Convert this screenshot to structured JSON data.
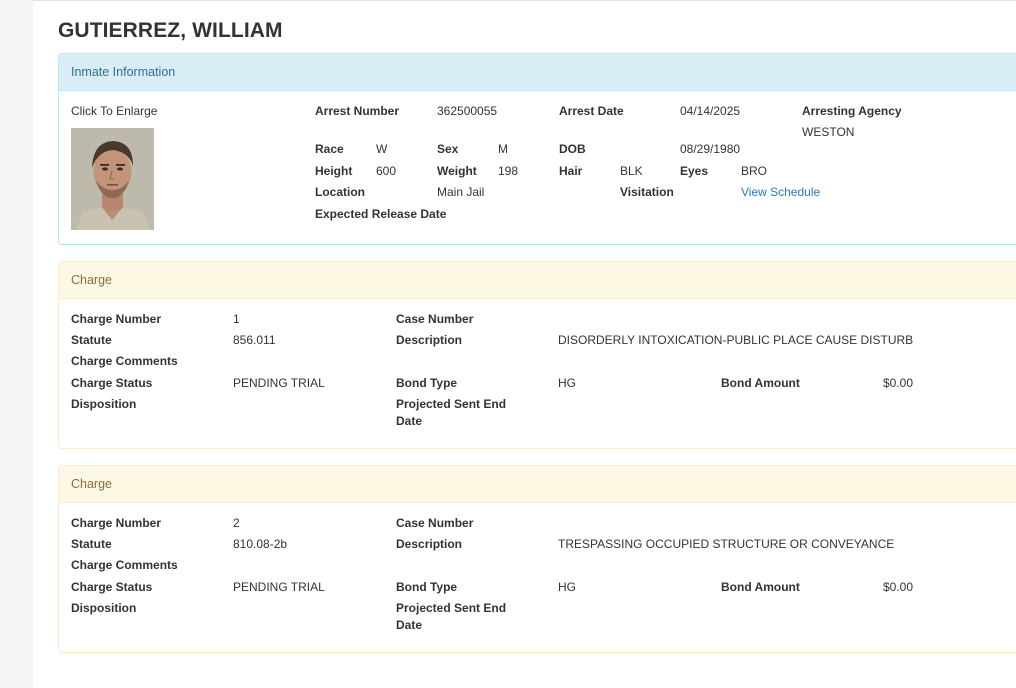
{
  "inmate": {
    "name": "GUTIERREZ, WILLIAM",
    "panel_title": "Inmate Information",
    "photo_label": "Click To Enlarge",
    "fields": {
      "arrest_number_label": "Arrest Number",
      "arrest_number": "362500055",
      "arrest_date_label": "Arrest Date",
      "arrest_date": "04/14/2025",
      "agency_label": "Arresting Agency",
      "agency": "WESTON",
      "race_label": "Race",
      "race": "W",
      "sex_label": "Sex",
      "sex": "M",
      "dob_label": "DOB",
      "dob": "08/29/1980",
      "height_label": "Height",
      "height": "600",
      "weight_label": "Weight",
      "weight": "198",
      "hair_label": "Hair",
      "hair": "BLK",
      "eyes_label": "Eyes",
      "eyes": "BRO",
      "location_label": "Location",
      "location": "Main Jail",
      "visitation_label": "Visitation",
      "visitation_link": "View Schedule",
      "release_label": "Expected Release Date"
    }
  },
  "charges": [
    {
      "panel_title": "Charge",
      "charge_number_label": "Charge Number",
      "charge_number": "1",
      "case_number_label": "Case Number",
      "statute_label": "Statute",
      "statute": "856.011",
      "description_label": "Description",
      "description": "DISORDERLY INTOXICATION-PUBLIC PLACE CAUSE DISTURB",
      "comments_label": "Charge Comments",
      "status_label": "Charge Status",
      "status": "PENDING TRIAL",
      "bond_type_label": "Bond Type",
      "bond_type": "HG",
      "bond_amount_label": "Bond Amount",
      "bond_amount": "$0.00",
      "disposition_label": "Disposition",
      "sent_end_label_1": "Projected Sent End",
      "sent_end_label_2": "Date"
    },
    {
      "panel_title": "Charge",
      "charge_number_label": "Charge Number",
      "charge_number": "2",
      "case_number_label": "Case Number",
      "statute_label": "Statute",
      "statute": "810.08-2b",
      "description_label": "Description",
      "description": "TRESPASSING OCCUPIED STRUCTURE OR CONVEYANCE",
      "comments_label": "Charge Comments",
      "status_label": "Charge Status",
      "status": "PENDING TRIAL",
      "bond_type_label": "Bond Type",
      "bond_type": "HG",
      "bond_amount_label": "Bond Amount",
      "bond_amount": "$0.00",
      "disposition_label": "Disposition",
      "sent_end_label_1": "Projected Sent End",
      "sent_end_label_2": "Date"
    }
  ],
  "colors": {
    "info_heading_bg": "#d9edf7",
    "info_heading_text": "#31708f",
    "charge_heading_bg": "#fcf8e3",
    "charge_heading_text": "#8a6d3b",
    "link": "#2a7ab8"
  }
}
